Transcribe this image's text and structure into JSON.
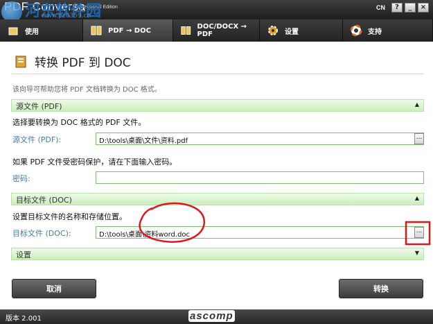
{
  "window": {
    "brand": "PDF Conversa",
    "edition": "Professional Edition",
    "watermark": "河东软件园",
    "watermark_url": "www.pc0359.cn",
    "lang": "CN",
    "help": "?",
    "minimize": "_",
    "close": "×"
  },
  "tabs": [
    {
      "label": "使用"
    },
    {
      "label": "PDF → DOC"
    },
    {
      "label": "DOC/DOCX → PDF"
    },
    {
      "label": "设置"
    },
    {
      "label": "支持"
    }
  ],
  "page": {
    "title": "转换 PDF 到 DOC",
    "intro": "该向导可帮助您将 PDF 文档转换为 DOC 格式。"
  },
  "source": {
    "section": "源文件 (PDF)",
    "desc": "选择要转换为 DOC 格式的 PDF 文件。",
    "label": "源文件 (PDF):",
    "value": "D:\\tools\\桌面\\文件\\资料.pdf",
    "password_desc": "如果 PDF 文件受密码保护，请在下面输入密码。",
    "password_label": "密码:",
    "password_value": ""
  },
  "target": {
    "section": "目标文件 (DOC)",
    "desc": "设置目标文件的名称和存储位置。",
    "label": "目标文件 (DOC):",
    "value": "D:\\tools\\桌面\\资料word.doc"
  },
  "settings_section": "设置",
  "browse_label": "...",
  "arrows": {
    "up": "▲",
    "down": "▼"
  },
  "buttons": {
    "cancel": "取消",
    "convert": "转换"
  },
  "footer": {
    "version": "版本 2.001",
    "logo": "ascomp"
  },
  "colors": {
    "section_bg": "#c9efbc",
    "field_border": "#7fbf6a",
    "label": "#4a7ba8",
    "annotation": "#e0161d"
  }
}
